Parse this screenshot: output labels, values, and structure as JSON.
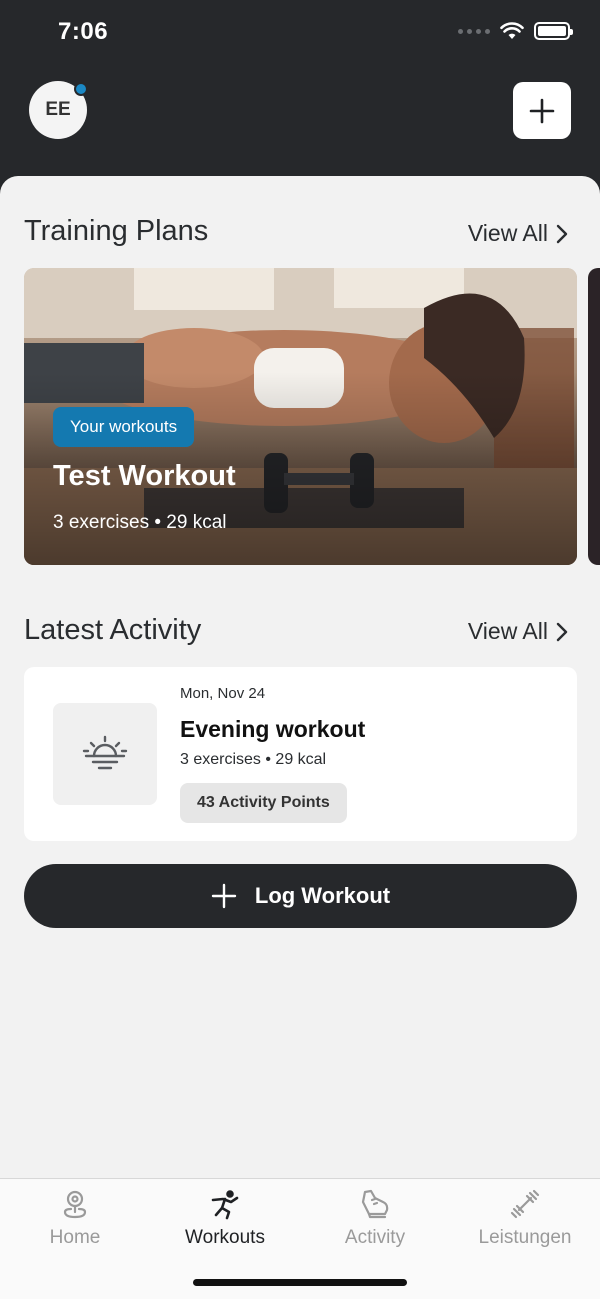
{
  "status_bar": {
    "time": "7:06"
  },
  "header": {
    "avatar_initials": "EE"
  },
  "training_plans": {
    "title": "Training Plans",
    "view_all": "View All",
    "card": {
      "badge": "Your workouts",
      "title": "Test Workout",
      "subtitle": "3 exercises • 29 kcal"
    }
  },
  "latest_activity": {
    "title": "Latest Activity",
    "view_all": "View All",
    "item": {
      "date": "Mon, Nov 24",
      "title": "Evening workout",
      "subtitle": "3 exercises • 29 kcal",
      "points": "43 Activity Points",
      "icon": "sunset-icon"
    }
  },
  "log_workout": {
    "label": "Log Workout"
  },
  "tabs": [
    {
      "label": "Home",
      "icon": "map-pin-icon",
      "active": false
    },
    {
      "label": "Workouts",
      "icon": "running-figure-icon",
      "active": true
    },
    {
      "label": "Activity",
      "icon": "shoe-icon",
      "active": false
    },
    {
      "label": "Leistungen",
      "icon": "dumbbell-icon",
      "active": false
    }
  ],
  "colors": {
    "header_bg": "#26282b",
    "badge_blue": "#1479b0",
    "notification_dot": "#1b88c4"
  }
}
